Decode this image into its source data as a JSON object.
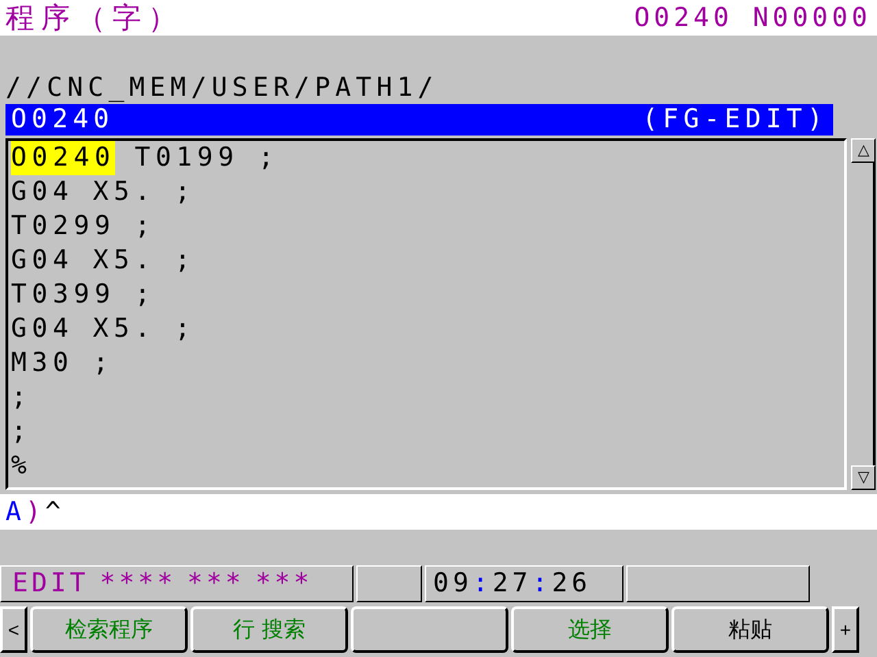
{
  "header": {
    "title": "程序（字）",
    "program_number": "O0240 N00000"
  },
  "path": "//CNC_MEM/USER/PATH1/",
  "program_bar": {
    "name": "O0240",
    "mode": "(FG-EDIT)"
  },
  "lines": [
    {
      "words": [
        {
          "text": "O0240",
          "selected": true
        },
        {
          "text": "T0199",
          "selected": false
        },
        {
          "text": ";",
          "selected": false
        }
      ]
    },
    {
      "words": [
        {
          "text": "G04",
          "selected": false
        },
        {
          "text": "X5.",
          "selected": false
        },
        {
          "text": ";",
          "selected": false
        }
      ]
    },
    {
      "words": [
        {
          "text": "T0299",
          "selected": false
        },
        {
          "text": ";",
          "selected": false
        }
      ]
    },
    {
      "words": [
        {
          "text": "G04",
          "selected": false
        },
        {
          "text": "X5.",
          "selected": false
        },
        {
          "text": ";",
          "selected": false
        }
      ]
    },
    {
      "words": [
        {
          "text": "T0399",
          "selected": false
        },
        {
          "text": ";",
          "selected": false
        }
      ]
    },
    {
      "words": [
        {
          "text": "G04",
          "selected": false
        },
        {
          "text": "X5.",
          "selected": false
        },
        {
          "text": ";",
          "selected": false
        }
      ]
    },
    {
      "words": [
        {
          "text": "M30",
          "selected": false
        },
        {
          "text": ";",
          "selected": false
        }
      ]
    },
    {
      "words": [
        {
          "text": ";",
          "selected": false
        }
      ]
    },
    {
      "words": [
        {
          "text": ";",
          "selected": false
        }
      ]
    },
    {
      "words": [
        {
          "text": "%",
          "selected": false
        }
      ]
    }
  ],
  "scrollbar": {
    "up": "△",
    "down": "▽"
  },
  "input": {
    "prompt": "A",
    "separator": ")",
    "value": "^"
  },
  "status": {
    "mode": "EDIT",
    "fields": [
      "****",
      "***",
      "***"
    ],
    "time": [
      "09",
      "27",
      "26"
    ],
    "time_separator": ":"
  },
  "softkeys": {
    "left": "<",
    "right": "+",
    "keys": [
      {
        "kind": "label",
        "label": "检索程序",
        "color": "#008000"
      },
      {
        "kind": "label",
        "label": "行 搜索",
        "color": "#008000"
      },
      {
        "kind": "blank"
      },
      {
        "kind": "label",
        "label": "选择",
        "color": "#008000"
      },
      {
        "kind": "label",
        "label": "粘贴",
        "color": "#000000"
      }
    ]
  }
}
